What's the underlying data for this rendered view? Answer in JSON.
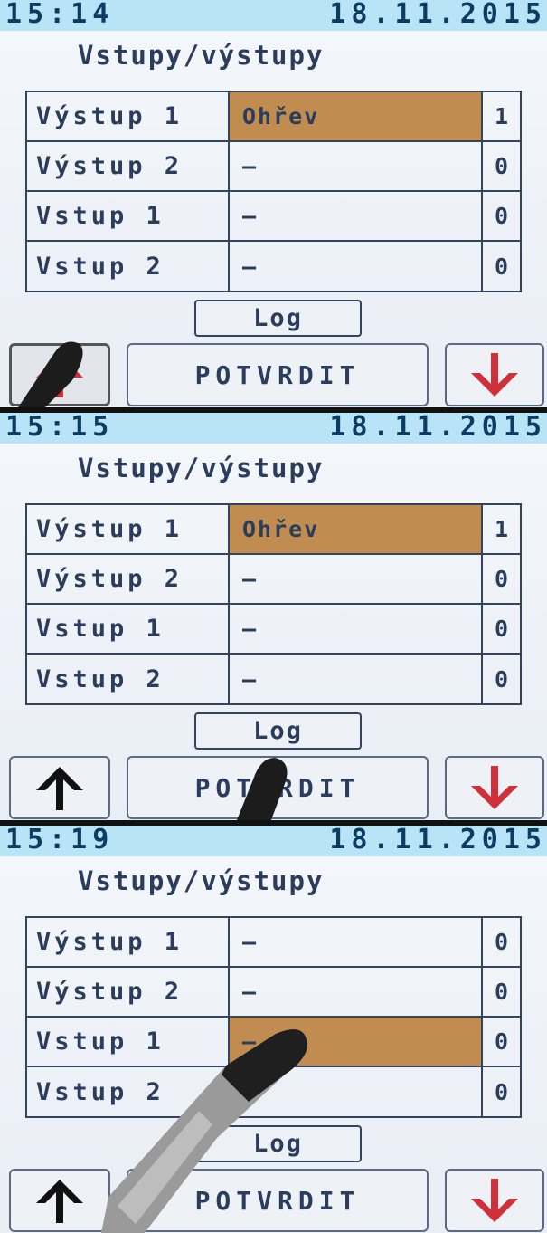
{
  "screens": [
    {
      "time": "15:14",
      "date": "18.11.2015",
      "title": "Vstupy/výstupy",
      "rows": [
        {
          "name": "Výstup 1",
          "func": "Ohřev",
          "value": "1"
        },
        {
          "name": "Výstup 2",
          "func": "–",
          "value": "0"
        },
        {
          "name": "Vstup 1",
          "func": "–",
          "value": "0"
        },
        {
          "name": "Vstup 2",
          "func": "–",
          "value": "0"
        }
      ],
      "selected_row": 0,
      "log_label": "Log",
      "confirm_label": "POTVRDIT"
    },
    {
      "time": "15:15",
      "date": "18.11.2015",
      "title": "Vstupy/výstupy",
      "rows": [
        {
          "name": "Výstup 1",
          "func": "Ohřev",
          "value": "1"
        },
        {
          "name": "Výstup 2",
          "func": "–",
          "value": "0"
        },
        {
          "name": "Vstup 1",
          "func": "–",
          "value": "0"
        },
        {
          "name": "Vstup 2",
          "func": "–",
          "value": "0"
        }
      ],
      "selected_row": 0,
      "log_label": "Log",
      "confirm_label": "POTVRDIT"
    },
    {
      "time": "15:19",
      "date": "18.11.2015",
      "title": "Vstupy/výstupy",
      "rows": [
        {
          "name": "Výstup 1",
          "func": "–",
          "value": "0"
        },
        {
          "name": "Výstup 2",
          "func": "–",
          "value": "0"
        },
        {
          "name": "Vstup 1",
          "func": "–",
          "value": "0"
        },
        {
          "name": "Vstup 2",
          "func": "–",
          "value": "0"
        }
      ],
      "selected_row": 2,
      "log_label": "Log",
      "confirm_label": "POTVRDIT"
    }
  ],
  "icons": {
    "up": "arrow-up-icon",
    "down": "arrow-down-icon"
  },
  "colors": {
    "status_bar": "#b9e3f7",
    "selected_row": "#c08c50",
    "arrow_up": "#111111",
    "arrow_down": "#d0303a"
  }
}
